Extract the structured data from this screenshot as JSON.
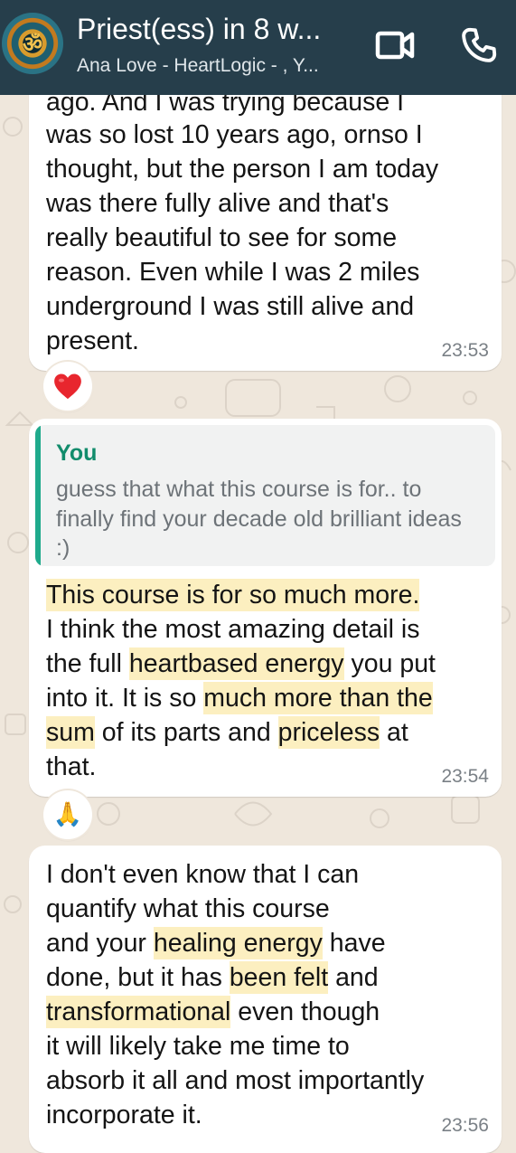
{
  "header": {
    "title": "Priest(ess) in 8 w...",
    "subtitle": "Ana Love - HeartLogic - , Y...",
    "avatar_glyph": "ॐ"
  },
  "icons": {
    "video_call": "video-camera-icon",
    "voice_call": "phone-icon",
    "heart_reaction": "heart-icon",
    "pray_reaction": "folded-hands-icon"
  },
  "colors": {
    "header_bg": "#263e4b",
    "chat_bg": "#efe7dc",
    "bubble_bg": "#ffffff",
    "quote_accent": "#1faa8c",
    "highlight": "#fcefc0",
    "heart": "#e8262e"
  },
  "messages": [
    {
      "partial_first_line": "ago. And I was trying because I",
      "text": "was so lost 10 years ago, ornso I\nthought, but the person I am today\nwas there fully alive and that's\nreally beautiful to see for some\nreason. Even while I was 2 miles\nunderground I was still alive and\npresent.",
      "time": "23:53",
      "reaction": "❤️"
    },
    {
      "quote_author": "You",
      "quote_text": "guess that what this course is for.. to finally find your decade old brilliant ideas :)",
      "segments": [
        {
          "text": "This course is for so much more.",
          "hl": true
        },
        {
          "text": "\nI think the most amazing detail is\nthe full ",
          "hl": false
        },
        {
          "text": "heartbased energy",
          "hl": true
        },
        {
          "text": " you put\ninto it. It is so ",
          "hl": false
        },
        {
          "text": "much more than the\nsum",
          "hl": true
        },
        {
          "text": " of its parts and ",
          "hl": false
        },
        {
          "text": "priceless",
          "hl": true
        },
        {
          "text": " at\nthat.",
          "hl": false
        }
      ],
      "time": "23:54",
      "reaction": "🙏"
    },
    {
      "segments": [
        {
          "text": "I don't even know that I can\nquantify what this course\nand your ",
          "hl": false
        },
        {
          "text": "healing energy",
          "hl": true
        },
        {
          "text": " have\ndone, but it has ",
          "hl": false
        },
        {
          "text": "been felt",
          "hl": true
        },
        {
          "text": " and\n",
          "hl": false
        },
        {
          "text": "transformational",
          "hl": true
        },
        {
          "text": " even though\nit will likely take me time to\nabsorb it all and most importantly\nincorporate it.",
          "hl": false
        }
      ],
      "time": "23:56"
    }
  ]
}
